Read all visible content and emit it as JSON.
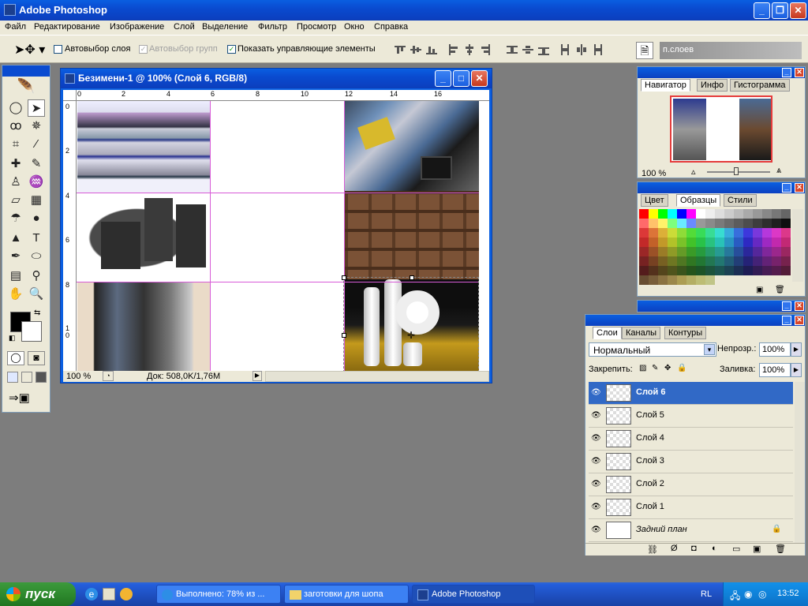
{
  "app": {
    "title": "Adobe Photoshop"
  },
  "menu": [
    "Файл",
    "Редактирование",
    "Изображение",
    "Слой",
    "Выделение",
    "Фильтр",
    "Просмотр",
    "Окно",
    "Справка"
  ],
  "options": {
    "autoselect_layer": "Автовыбор слоя",
    "autoselect_group": "Автовыбор групп",
    "show_controls": "Показать управляющие элементы",
    "palette_well_label": "п.слоев"
  },
  "document": {
    "title": "Безимени-1 @ 100% (Слой 6, RGB/8)",
    "ruler_top": [
      "0",
      "2",
      "4",
      "6",
      "8",
      "10",
      "12",
      "14",
      "16"
    ],
    "ruler_left": [
      "0",
      "2",
      "4",
      "6",
      "8",
      "1\n0"
    ],
    "zoom": "100 %",
    "doc_size": "Док: 508,0K/1,76M"
  },
  "navigator": {
    "tabs": [
      "Навигатор",
      "Инфо",
      "Гистограмма"
    ],
    "zoom": "100 %"
  },
  "swatches": {
    "tabs": [
      "Цвет",
      "Образцы",
      "Стили"
    ]
  },
  "layers": {
    "tabs": [
      "Слои",
      "Каналы",
      "Контуры"
    ],
    "blend_mode": "Нормальный",
    "opacity_label": "Непрозр.:",
    "opacity": "100%",
    "lock_label": "Закрепить:",
    "fill_label": "Заливка:",
    "fill": "100%",
    "items": [
      {
        "name": "Слой 6",
        "selected": true
      },
      {
        "name": "Слой 5",
        "selected": false
      },
      {
        "name": "Слой 4",
        "selected": false
      },
      {
        "name": "Слой 3",
        "selected": false
      },
      {
        "name": "Слой 2",
        "selected": false
      },
      {
        "name": "Слой 1",
        "selected": false
      },
      {
        "name": "Задний план",
        "selected": false
      }
    ]
  },
  "taskbar": {
    "start": "пуск",
    "tasks": [
      "Выполнено: 78% из ...",
      "заготовки для шопа",
      "Adobe Photoshop"
    ],
    "lang": "RL",
    "time": "13:52"
  },
  "colors": {
    "xp_blue": "#0a4bd0",
    "face": "#ece9d8",
    "selection": "#3169c6"
  }
}
